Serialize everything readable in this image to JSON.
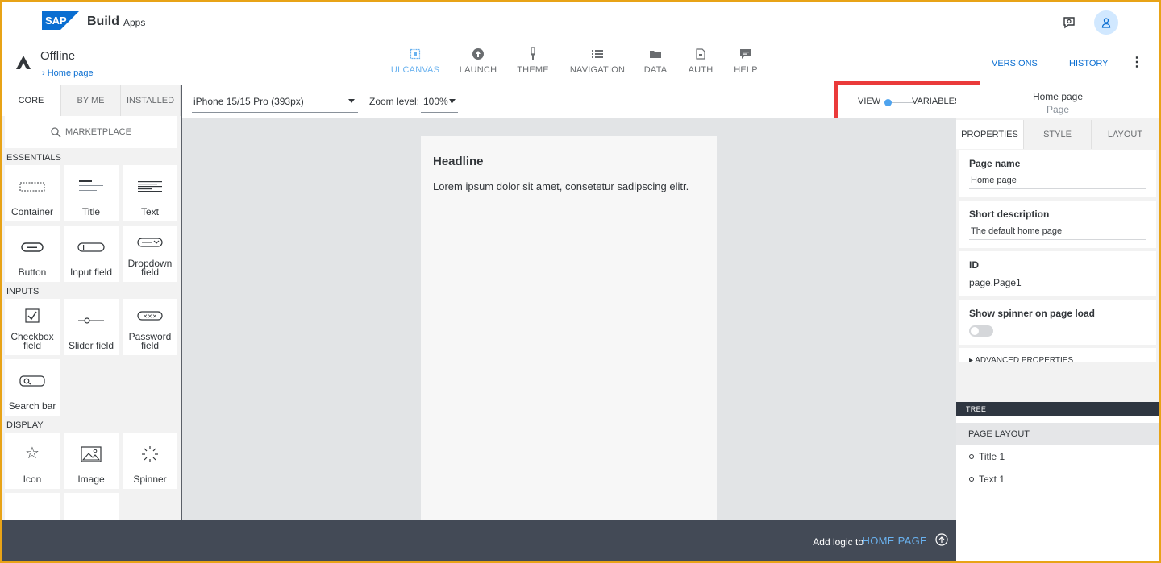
{
  "shell": {
    "logo_text": "SAP",
    "brand": "Build",
    "brand_sub": "Apps"
  },
  "app": {
    "title": "Offline",
    "breadcrumb": "Home page",
    "nav": [
      {
        "label": "UI CANVAS",
        "icon": "ui-canvas-icon",
        "active": true
      },
      {
        "label": "LAUNCH",
        "icon": "launch-icon",
        "active": false
      },
      {
        "label": "THEME",
        "icon": "theme-icon",
        "active": false
      },
      {
        "label": "NAVIGATION",
        "icon": "navigation-icon",
        "active": false
      },
      {
        "label": "DATA",
        "icon": "data-icon",
        "active": false
      },
      {
        "label": "AUTH",
        "icon": "auth-icon",
        "active": false
      },
      {
        "label": "HELP",
        "icon": "help-icon",
        "active": false
      }
    ],
    "versions": "VERSIONS",
    "history": "HISTORY"
  },
  "left": {
    "tabs": [
      "CORE",
      "BY ME",
      "INSTALLED"
    ],
    "marketplace": "MARKETPLACE",
    "sections": {
      "essentials": "ESSENTIALS",
      "inputs": "INPUTS",
      "display": "DISPLAY"
    },
    "essentials": [
      "Container",
      "Title",
      "Text",
      "Button",
      "Input field",
      "Dropdown field"
    ],
    "inputs": [
      "Checkbox field",
      "Slider field",
      "Password field",
      "Search bar"
    ],
    "display": [
      "Icon",
      "Image",
      "Spinner"
    ]
  },
  "toolbar": {
    "device": "iPhone 15/15 Pro (393px)",
    "zoom_label": "Zoom level:",
    "zoom_value": "100%",
    "view": "VIEW",
    "variables": "VARIABLES"
  },
  "canvas": {
    "headline": "Headline",
    "text": "Lorem ipsum dolor sit amet, consetetur sadipscing elitr."
  },
  "bottom": {
    "add_logic": "Add logic to",
    "target": "HOME PAGE"
  },
  "right": {
    "title": "Home page",
    "subtitle": "Page",
    "tabs": [
      "PROPERTIES",
      "STYLE",
      "LAYOUT"
    ],
    "page_name_label": "Page name",
    "page_name": "Home page",
    "short_desc_label": "Short description",
    "short_desc": "The default home page",
    "id_label": "ID",
    "id_value": "page.Page1",
    "spinner_label": "Show spinner on page load",
    "advanced": "ADVANCED PROPERTIES",
    "tree": "TREE",
    "page_layout": "PAGE LAYOUT",
    "nodes": [
      "Title 1",
      "Text 1"
    ]
  },
  "colors": {
    "accent": "#0a6ed1",
    "active_tab": "#6ab2ef",
    "highlight_box": "#ea3a3a",
    "bottom_bar": "#434a56",
    "frame": "#e8a317"
  }
}
